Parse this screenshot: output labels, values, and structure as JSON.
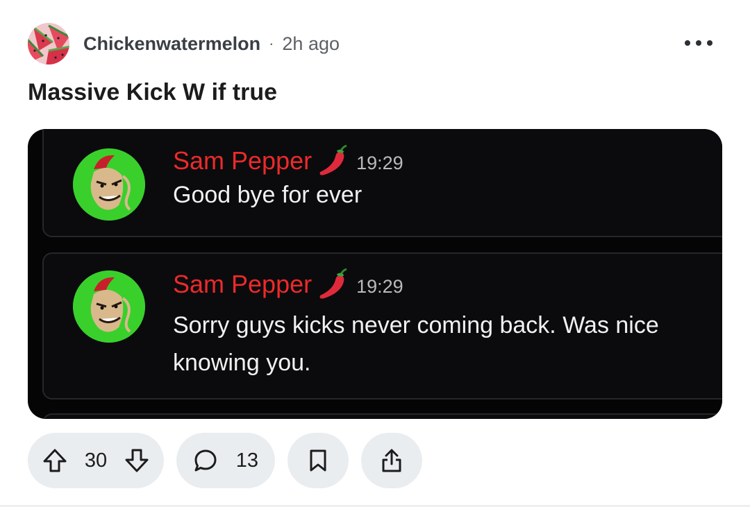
{
  "post": {
    "author": "Chickenwatermelon",
    "separator": "·",
    "time": "2h ago",
    "title": "Massive Kick W if true",
    "more_icon": "more-horizontal-icon"
  },
  "media": {
    "messages": [
      {
        "author": "Sam Pepper",
        "badge": "chili-pepper-icon",
        "time": "19:29",
        "text": "Good bye for ever"
      },
      {
        "author": "Sam Pepper",
        "badge": "chili-pepper-icon",
        "time": "19:29",
        "text": "Sorry guys kicks never coming back. Was nice knowing you."
      }
    ],
    "colors": {
      "background": "#050506",
      "author": "#ec2a2a",
      "avatar_bg": "#39d02c"
    }
  },
  "actions": {
    "upvotes": "30",
    "comments": "13",
    "icons": [
      "upvote-icon",
      "downvote-icon",
      "comment-icon",
      "bookmark-icon",
      "share-icon"
    ]
  }
}
